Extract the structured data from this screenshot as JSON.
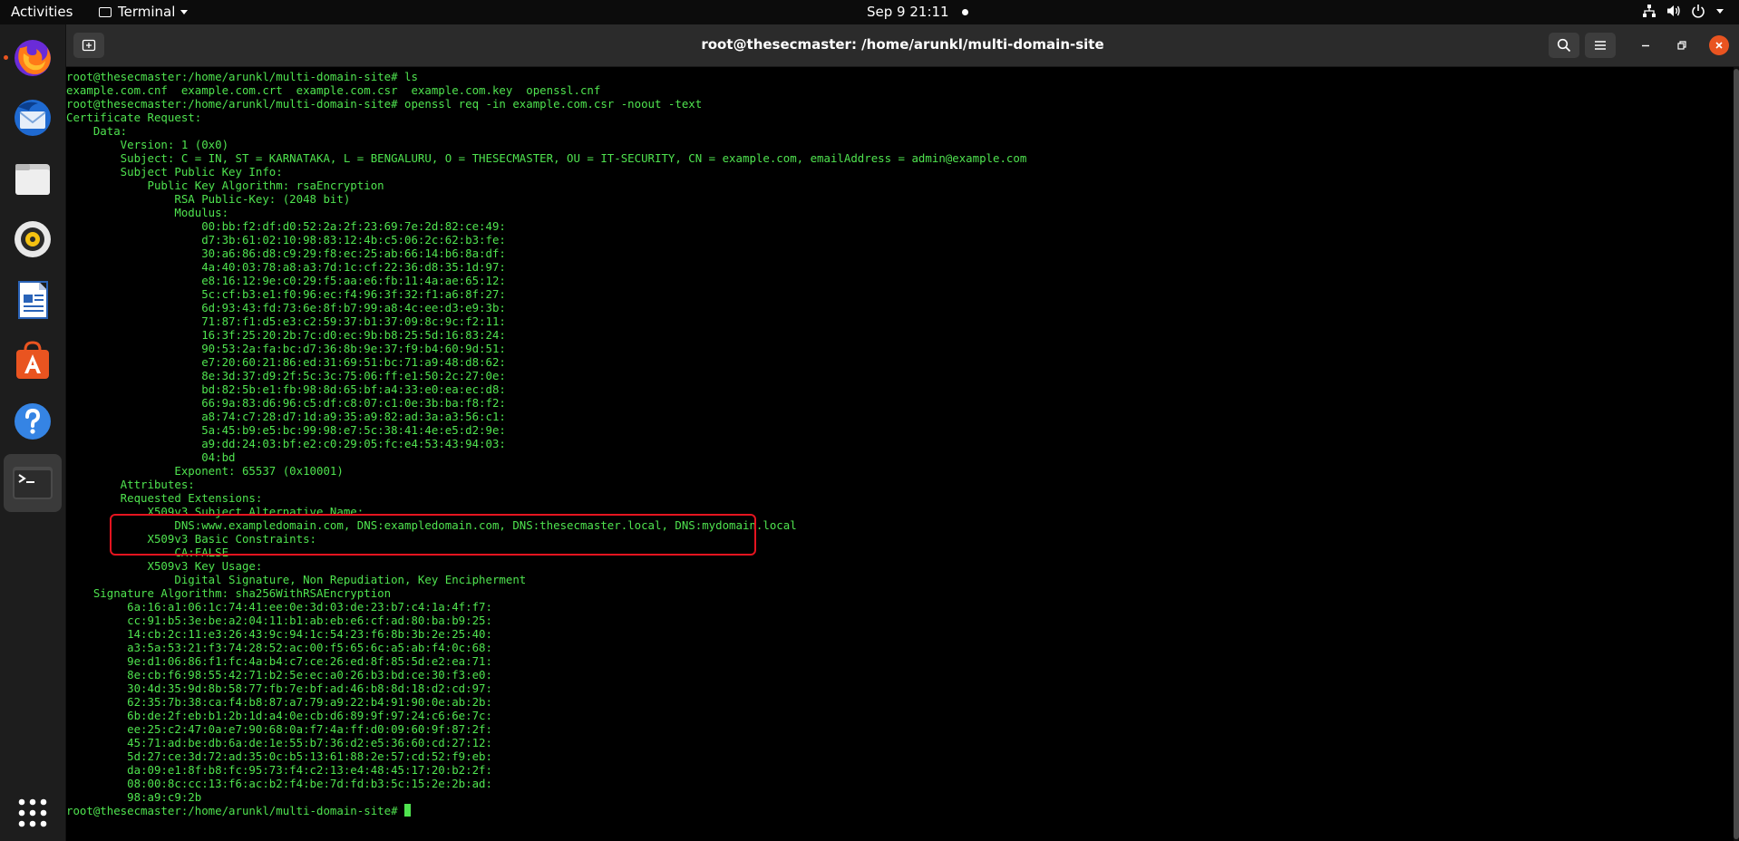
{
  "topbar": {
    "activities_label": "Activities",
    "app_menu_label": "Terminal",
    "clock": "Sep 9  21:11"
  },
  "dock": {
    "items": [
      {
        "name": "firefox",
        "icon": "firefox-icon",
        "running": true
      },
      {
        "name": "thunderbird",
        "icon": "thunderbird-icon",
        "running": false
      },
      {
        "name": "files",
        "icon": "files-icon",
        "running": false
      },
      {
        "name": "rhythmbox",
        "icon": "rhythmbox-icon",
        "running": false
      },
      {
        "name": "libreoffice-writer",
        "icon": "writer-icon",
        "running": false
      },
      {
        "name": "ubuntu-software",
        "icon": "software-icon",
        "running": false
      },
      {
        "name": "help",
        "icon": "help-icon",
        "running": false
      },
      {
        "name": "terminal",
        "icon": "terminal-icon",
        "running": true
      }
    ],
    "show_apps_icon": "apps-grid-icon"
  },
  "window": {
    "title": "root@thesecmaster: /home/arunkl/multi-domain-site"
  },
  "colors": {
    "terminal_text": "#4fe34f",
    "highlight_border": "#e5141f",
    "accent": "#e95420"
  },
  "terminal": {
    "prompt": "root@thesecmaster:/home/arunkl/multi-domain-site# ",
    "lines": [
      "root@thesecmaster:/home/arunkl/multi-domain-site# ls",
      "example.com.cnf  example.com.crt  example.com.csr  example.com.key  openssl.cnf",
      "root@thesecmaster:/home/arunkl/multi-domain-site# openssl req -in example.com.csr -noout -text",
      "Certificate Request:",
      "    Data:",
      "        Version: 1 (0x0)",
      "        Subject: C = IN, ST = KARNATAKA, L = BENGALURU, O = THESECMASTER, OU = IT-SECURITY, CN = example.com, emailAddress = admin@example.com",
      "        Subject Public Key Info:",
      "            Public Key Algorithm: rsaEncryption",
      "                RSA Public-Key: (2048 bit)",
      "                Modulus:",
      "                    00:bb:f2:df:d0:52:2a:2f:23:69:7e:2d:82:ce:49:",
      "                    d7:3b:61:02:10:98:83:12:4b:c5:06:2c:62:b3:fe:",
      "                    30:a6:86:d8:c9:29:f8:ec:25:ab:66:14:b6:8a:df:",
      "                    4a:40:03:78:a8:a3:7d:1c:cf:22:36:d8:35:1d:97:",
      "                    e8:16:12:9e:c0:29:f5:aa:e6:fb:11:4a:ae:65:12:",
      "                    5c:cf:b3:e1:f0:96:ec:f4:96:3f:32:f1:a6:8f:27:",
      "                    6d:93:43:fd:73:6e:8f:b7:99:a8:4c:ee:d3:e9:3b:",
      "                    71:87:f1:d5:e3:c2:59:37:b1:37:09:8c:9c:f2:11:",
      "                    16:3f:25:20:2b:7c:d0:ec:9b:b8:25:5d:16:83:24:",
      "                    90:53:2a:fa:bc:d7:36:8b:9e:37:f9:b4:60:9d:51:",
      "                    e7:20:60:21:86:ed:31:69:51:bc:71:a9:48:d8:62:",
      "                    8e:3d:37:d9:2f:5c:3c:75:06:ff:e1:50:2c:27:0e:",
      "                    bd:82:5b:e1:fb:98:8d:65:bf:a4:33:e0:ea:ec:d8:",
      "                    66:9a:83:d6:96:c5:df:c8:07:c1:0e:3b:ba:f8:f2:",
      "                    a8:74:c7:28:d7:1d:a9:35:a9:82:ad:3a:a3:56:c1:",
      "                    5a:45:b9:e5:bc:99:98:e7:5c:38:41:4e:e5:d2:9e:",
      "                    a9:dd:24:03:bf:e2:c0:29:05:fc:e4:53:43:94:03:",
      "                    04:bd",
      "                Exponent: 65537 (0x10001)",
      "        Attributes:",
      "        Requested Extensions:",
      "            X509v3 Subject Alternative Name:",
      "                DNS:www.exampledomain.com, DNS:exampledomain.com, DNS:thesecmaster.local, DNS:mydomain.local",
      "            X509v3 Basic Constraints:",
      "                CA:FALSE",
      "            X509v3 Key Usage:",
      "                Digital Signature, Non Repudiation, Key Encipherment",
      "    Signature Algorithm: sha256WithRSAEncryption",
      "         6a:16:a1:06:1c:74:41:ee:0e:3d:03:de:23:b7:c4:1a:4f:f7:",
      "         cc:91:b5:3e:be:a2:04:11:b1:ab:eb:e6:cf:ad:80:ba:b9:25:",
      "         14:cb:2c:11:e3:26:43:9c:94:1c:54:23:f6:8b:3b:2e:25:40:",
      "         a3:5a:53:21:f3:74:28:52:ac:00:f5:65:6c:a5:ab:f4:0c:68:",
      "         9e:d1:06:86:f1:fc:4a:b4:c7:ce:26:ed:8f:85:5d:e2:ea:71:",
      "         8e:cb:f6:98:55:42:71:b2:5e:ec:a0:26:b3:bd:ce:30:f3:e0:",
      "         30:4d:35:9d:8b:58:77:fb:7e:bf:ad:46:b8:8d:18:d2:cd:97:",
      "         62:35:7b:38:ca:f4:b8:87:a7:79:a9:22:b4:91:90:0e:ab:2b:",
      "         6b:de:2f:eb:b1:2b:1d:a4:0e:cb:d6:89:9f:97:24:c6:6e:7c:",
      "         ee:25:c2:47:0a:e7:90:68:0a:f7:4a:ff:d0:09:60:9f:87:2f:",
      "         45:71:ad:be:db:6a:de:1e:55:b7:36:d2:e5:36:60:cd:27:12:",
      "         5d:27:ce:3d:72:ad:35:0c:b5:13:61:88:2e:57:cd:52:f9:eb:",
      "         da:09:e1:8f:b8:fc:95:73:f4:c2:13:e4:48:45:17:20:b2:2f:",
      "         08:00:8c:cc:13:f6:ac:b2:f4:be:7d:fd:b3:5c:15:2e:2b:ad:",
      "         98:a9:c9:2b"
    ]
  }
}
